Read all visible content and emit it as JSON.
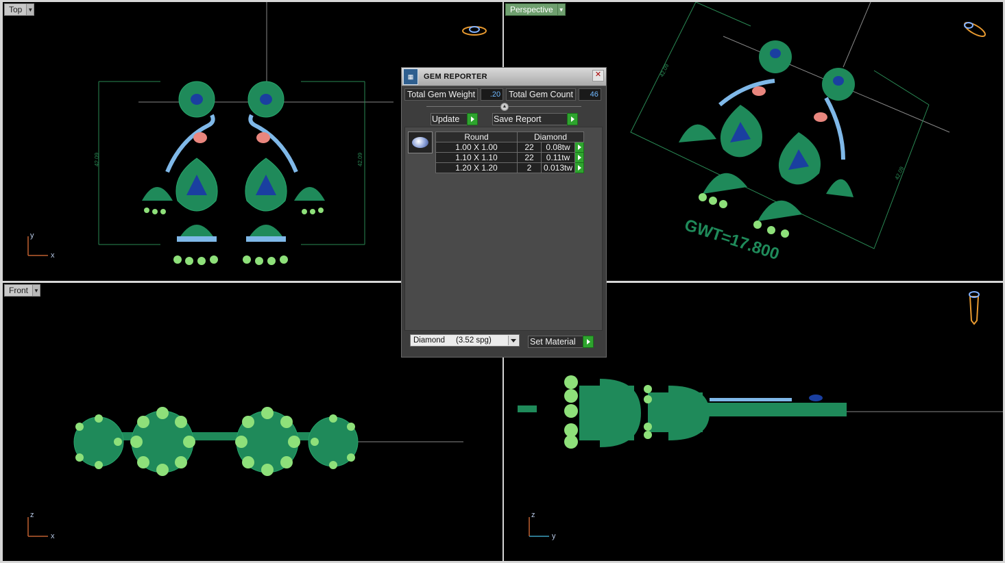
{
  "viewports": {
    "top": {
      "label": "Top",
      "axis_v": "y",
      "axis_h": "x",
      "dims": "42.09"
    },
    "perspective": {
      "label": "Perspective",
      "dims": "42.09",
      "gwt": "GWT=17.800"
    },
    "front": {
      "label": "Front",
      "axis_v": "z",
      "axis_h": "x"
    },
    "right": {
      "axis_v": "z",
      "axis_h": "y"
    }
  },
  "gem_reporter": {
    "title": "GEM REPORTER",
    "total_weight_label": "Total Gem Weight",
    "total_weight_value": ".20",
    "total_count_label": "Total Gem Count",
    "total_count_value": "46",
    "update_label": "Update",
    "save_label": "Save Report",
    "table": {
      "shape": "Round",
      "material": "Diamond",
      "rows": [
        {
          "size": "1.00 X 1.00",
          "count": "22",
          "weight": "0.08tw"
        },
        {
          "size": "1.10 X 1.10",
          "count": "22",
          "weight": "0.11tw"
        },
        {
          "size": "1.20 X 1.20",
          "count": "2",
          "weight": "0.013tw"
        }
      ]
    },
    "material_select": "Diamond     (3.52 spg)",
    "set_material_label": "Set Material"
  },
  "colors": {
    "viewport_bg": "#000000",
    "metal": "#1f8a5a",
    "gem_blue": "#1a3fa0",
    "active_label": "#6f9f6f"
  }
}
